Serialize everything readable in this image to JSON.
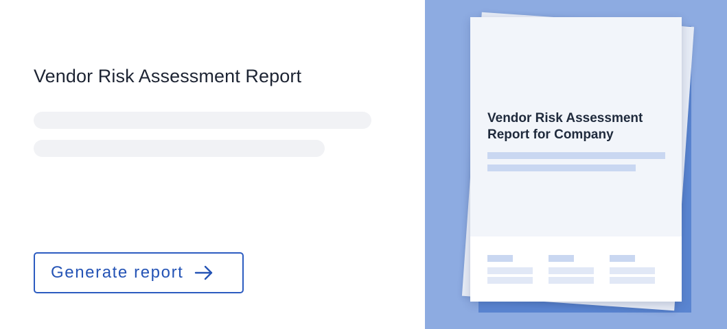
{
  "main": {
    "title": "Vendor Risk Assessment Report",
    "generate_button_label": "Generate report",
    "generate_button_icon": "arrow-right-icon"
  },
  "preview": {
    "document_title": "Vendor Risk Assessment Report for Company"
  },
  "colors": {
    "accent": "#2b5bc0",
    "preview_background": "#8dabe1",
    "sheet_back": "#5a85d1",
    "skeleton": "#f1f2f5"
  }
}
